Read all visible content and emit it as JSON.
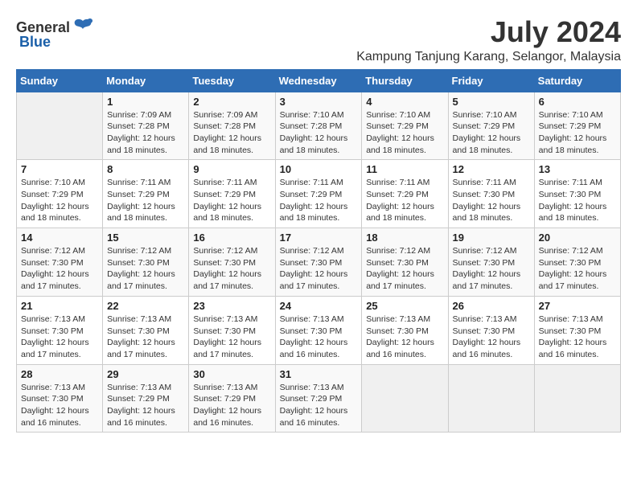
{
  "logo": {
    "general": "General",
    "blue": "Blue"
  },
  "title": "July 2024",
  "subtitle": "Kampung Tanjung Karang, Selangor, Malaysia",
  "days_header": [
    "Sunday",
    "Monday",
    "Tuesday",
    "Wednesday",
    "Thursday",
    "Friday",
    "Saturday"
  ],
  "weeks": [
    [
      {
        "day": "",
        "info": ""
      },
      {
        "day": "1",
        "info": "Sunrise: 7:09 AM\nSunset: 7:28 PM\nDaylight: 12 hours and 18 minutes."
      },
      {
        "day": "2",
        "info": "Sunrise: 7:09 AM\nSunset: 7:28 PM\nDaylight: 12 hours and 18 minutes."
      },
      {
        "day": "3",
        "info": "Sunrise: 7:10 AM\nSunset: 7:28 PM\nDaylight: 12 hours and 18 minutes."
      },
      {
        "day": "4",
        "info": "Sunrise: 7:10 AM\nSunset: 7:29 PM\nDaylight: 12 hours and 18 minutes."
      },
      {
        "day": "5",
        "info": "Sunrise: 7:10 AM\nSunset: 7:29 PM\nDaylight: 12 hours and 18 minutes."
      },
      {
        "day": "6",
        "info": "Sunrise: 7:10 AM\nSunset: 7:29 PM\nDaylight: 12 hours and 18 minutes."
      }
    ],
    [
      {
        "day": "7",
        "info": "Sunrise: 7:10 AM\nSunset: 7:29 PM\nDaylight: 12 hours and 18 minutes."
      },
      {
        "day": "8",
        "info": "Sunrise: 7:11 AM\nSunset: 7:29 PM\nDaylight: 12 hours and 18 minutes."
      },
      {
        "day": "9",
        "info": "Sunrise: 7:11 AM\nSunset: 7:29 PM\nDaylight: 12 hours and 18 minutes."
      },
      {
        "day": "10",
        "info": "Sunrise: 7:11 AM\nSunset: 7:29 PM\nDaylight: 12 hours and 18 minutes."
      },
      {
        "day": "11",
        "info": "Sunrise: 7:11 AM\nSunset: 7:29 PM\nDaylight: 12 hours and 18 minutes."
      },
      {
        "day": "12",
        "info": "Sunrise: 7:11 AM\nSunset: 7:30 PM\nDaylight: 12 hours and 18 minutes."
      },
      {
        "day": "13",
        "info": "Sunrise: 7:11 AM\nSunset: 7:30 PM\nDaylight: 12 hours and 18 minutes."
      }
    ],
    [
      {
        "day": "14",
        "info": "Sunrise: 7:12 AM\nSunset: 7:30 PM\nDaylight: 12 hours and 17 minutes."
      },
      {
        "day": "15",
        "info": "Sunrise: 7:12 AM\nSunset: 7:30 PM\nDaylight: 12 hours and 17 minutes."
      },
      {
        "day": "16",
        "info": "Sunrise: 7:12 AM\nSunset: 7:30 PM\nDaylight: 12 hours and 17 minutes."
      },
      {
        "day": "17",
        "info": "Sunrise: 7:12 AM\nSunset: 7:30 PM\nDaylight: 12 hours and 17 minutes."
      },
      {
        "day": "18",
        "info": "Sunrise: 7:12 AM\nSunset: 7:30 PM\nDaylight: 12 hours and 17 minutes."
      },
      {
        "day": "19",
        "info": "Sunrise: 7:12 AM\nSunset: 7:30 PM\nDaylight: 12 hours and 17 minutes."
      },
      {
        "day": "20",
        "info": "Sunrise: 7:12 AM\nSunset: 7:30 PM\nDaylight: 12 hours and 17 minutes."
      }
    ],
    [
      {
        "day": "21",
        "info": "Sunrise: 7:13 AM\nSunset: 7:30 PM\nDaylight: 12 hours and 17 minutes."
      },
      {
        "day": "22",
        "info": "Sunrise: 7:13 AM\nSunset: 7:30 PM\nDaylight: 12 hours and 17 minutes."
      },
      {
        "day": "23",
        "info": "Sunrise: 7:13 AM\nSunset: 7:30 PM\nDaylight: 12 hours and 17 minutes."
      },
      {
        "day": "24",
        "info": "Sunrise: 7:13 AM\nSunset: 7:30 PM\nDaylight: 12 hours and 16 minutes."
      },
      {
        "day": "25",
        "info": "Sunrise: 7:13 AM\nSunset: 7:30 PM\nDaylight: 12 hours and 16 minutes."
      },
      {
        "day": "26",
        "info": "Sunrise: 7:13 AM\nSunset: 7:30 PM\nDaylight: 12 hours and 16 minutes."
      },
      {
        "day": "27",
        "info": "Sunrise: 7:13 AM\nSunset: 7:30 PM\nDaylight: 12 hours and 16 minutes."
      }
    ],
    [
      {
        "day": "28",
        "info": "Sunrise: 7:13 AM\nSunset: 7:30 PM\nDaylight: 12 hours and 16 minutes."
      },
      {
        "day": "29",
        "info": "Sunrise: 7:13 AM\nSunset: 7:29 PM\nDaylight: 12 hours and 16 minutes."
      },
      {
        "day": "30",
        "info": "Sunrise: 7:13 AM\nSunset: 7:29 PM\nDaylight: 12 hours and 16 minutes."
      },
      {
        "day": "31",
        "info": "Sunrise: 7:13 AM\nSunset: 7:29 PM\nDaylight: 12 hours and 16 minutes."
      },
      {
        "day": "",
        "info": ""
      },
      {
        "day": "",
        "info": ""
      },
      {
        "day": "",
        "info": ""
      }
    ]
  ]
}
